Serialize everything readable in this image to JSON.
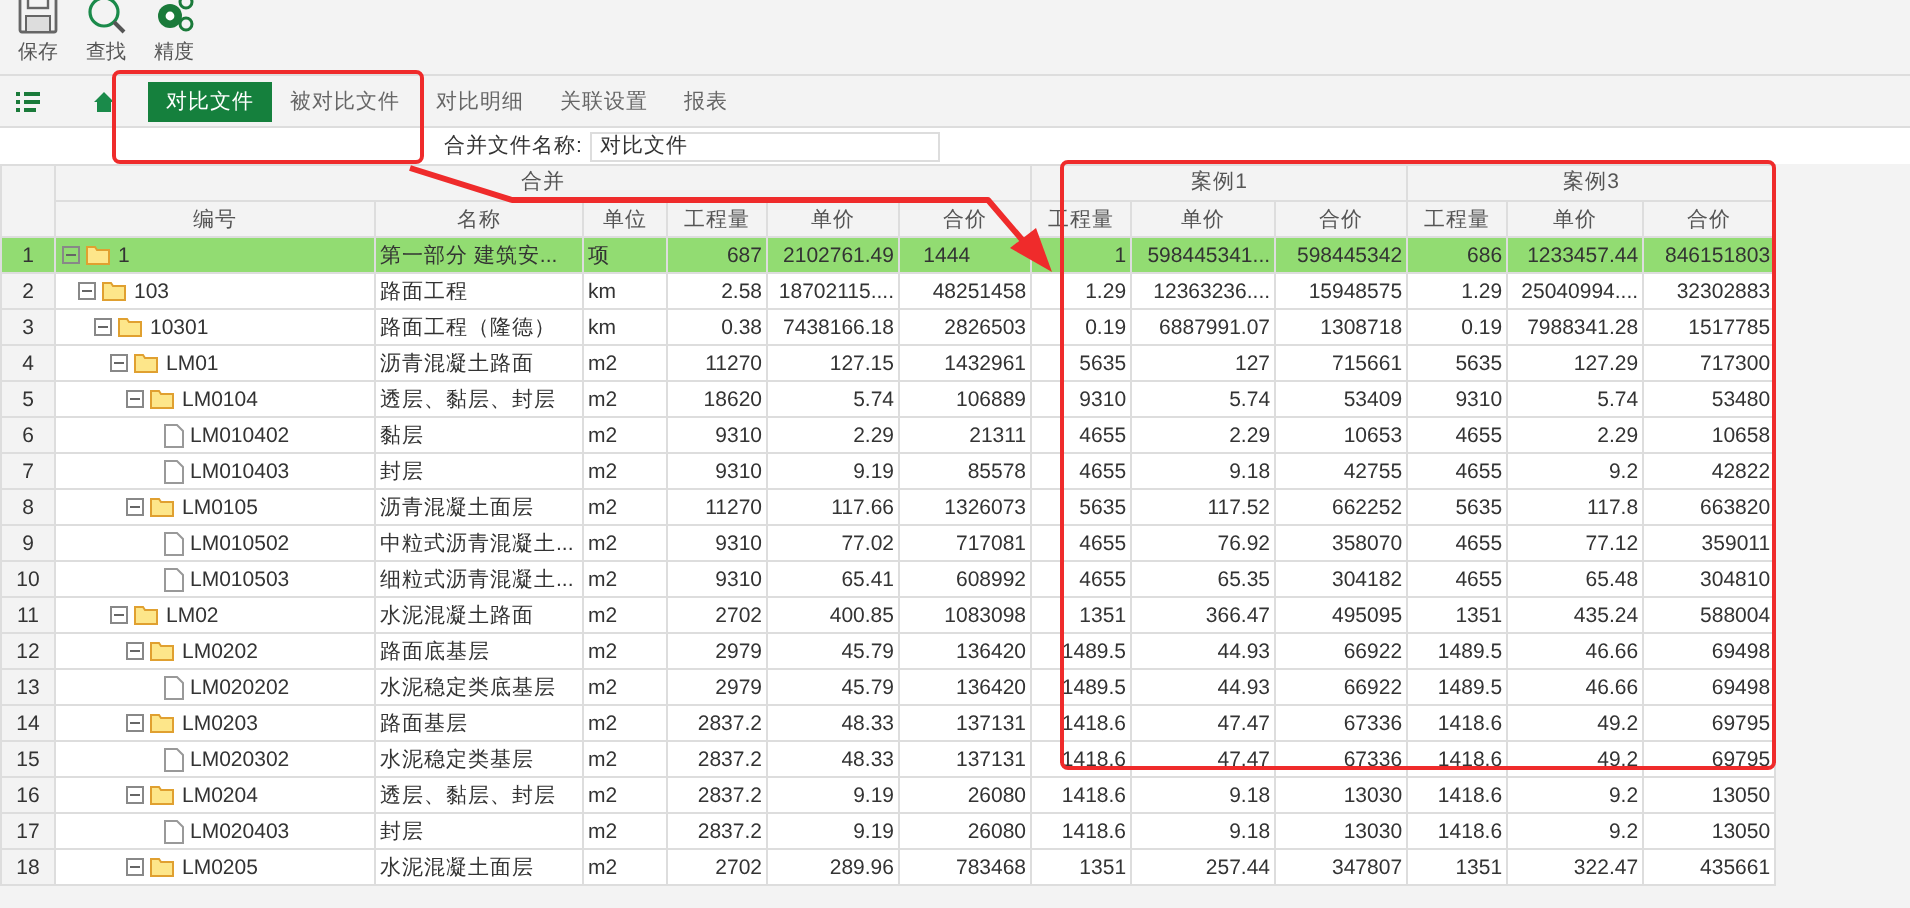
{
  "toolbar": [
    {
      "kind": "save",
      "label": "保存"
    },
    {
      "kind": "search",
      "label": "查找"
    },
    {
      "kind": "gears",
      "label": "精度"
    }
  ],
  "tabs": [
    {
      "label": "对比文件",
      "selected": true
    },
    {
      "label": "被对比文件",
      "selected": false
    },
    {
      "label": "对比明细",
      "selected": false
    },
    {
      "label": "关联设置",
      "selected": false
    },
    {
      "label": "报表",
      "selected": false
    }
  ],
  "merge_file": {
    "label": "合并文件名称:",
    "value": "对比文件"
  },
  "table": {
    "groups": [
      {
        "label": "合并",
        "columns": [
          "编号",
          "名称",
          "单位",
          "工程量",
          "单价",
          "合价"
        ]
      },
      {
        "label": "案例1",
        "columns": [
          "工程量",
          "单价",
          "合价"
        ]
      },
      {
        "label": "案例3",
        "columns": [
          "工程量",
          "单价",
          "合价"
        ]
      }
    ],
    "rows": [
      {
        "num": "1",
        "code": "1",
        "kind": "folder",
        "expanded": true,
        "selected": true,
        "cells": [
          "第一部分 建筑安...",
          "项",
          "687",
          "2102761.49",
          "1444",
          "1",
          "598445341...",
          "598445342",
          "686",
          "1233457.44",
          "846151803"
        ],
        "children": [
          {
            "num": "2",
            "code": "103",
            "kind": "folder",
            "expanded": true,
            "selected": false,
            "cells": [
              "路面工程",
              "km",
              "2.58",
              "18702115....",
              "48251458",
              "1.29",
              "12363236....",
              "15948575",
              "1.29",
              "25040994....",
              "32302883"
            ],
            "children": [
              {
                "num": "3",
                "code": "10301",
                "kind": "folder",
                "expanded": true,
                "selected": false,
                "cells": [
                  "路面工程（隆德）",
                  "km",
                  "0.38",
                  "7438166.18",
                  "2826503",
                  "0.19",
                  "6887991.07",
                  "1308718",
                  "0.19",
                  "7988341.28",
                  "1517785"
                ],
                "children": [
                  {
                    "num": "4",
                    "code": "LM01",
                    "kind": "folder",
                    "expanded": true,
                    "selected": false,
                    "cells": [
                      "沥青混凝土路面",
                      "m2",
                      "11270",
                      "127.15",
                      "1432961",
                      "5635",
                      "127",
                      "715661",
                      "5635",
                      "127.29",
                      "717300"
                    ],
                    "children": [
                      {
                        "num": "5",
                        "code": "LM0104",
                        "kind": "folder",
                        "expanded": true,
                        "selected": false,
                        "cells": [
                          "透层、黏层、封层",
                          "m2",
                          "18620",
                          "5.74",
                          "106889",
                          "9310",
                          "5.74",
                          "53409",
                          "9310",
                          "5.74",
                          "53480"
                        ],
                        "children": [
                          {
                            "num": "6",
                            "code": "LM010402",
                            "kind": "file",
                            "selected": false,
                            "cells": [
                              "黏层",
                              "m2",
                              "9310",
                              "2.29",
                              "21311",
                              "4655",
                              "2.29",
                              "10653",
                              "4655",
                              "2.29",
                              "10658"
                            ]
                          },
                          {
                            "num": "7",
                            "code": "LM010403",
                            "kind": "file",
                            "selected": false,
                            "cells": [
                              "封层",
                              "m2",
                              "9310",
                              "9.19",
                              "85578",
                              "4655",
                              "9.18",
                              "42755",
                              "4655",
                              "9.2",
                              "42822"
                            ]
                          }
                        ]
                      },
                      {
                        "num": "8",
                        "code": "LM0105",
                        "kind": "folder",
                        "expanded": true,
                        "selected": false,
                        "cells": [
                          "沥青混凝土面层",
                          "m2",
                          "11270",
                          "117.66",
                          "1326073",
                          "5635",
                          "117.52",
                          "662252",
                          "5635",
                          "117.8",
                          "663820"
                        ],
                        "children": [
                          {
                            "num": "9",
                            "code": "LM010502",
                            "kind": "file",
                            "selected": false,
                            "cells": [
                              "中粒式沥青混凝土...",
                              "m2",
                              "9310",
                              "77.02",
                              "717081",
                              "4655",
                              "76.92",
                              "358070",
                              "4655",
                              "77.12",
                              "359011"
                            ]
                          },
                          {
                            "num": "10",
                            "code": "LM010503",
                            "kind": "file",
                            "selected": false,
                            "cells": [
                              "细粒式沥青混凝土...",
                              "m2",
                              "9310",
                              "65.41",
                              "608992",
                              "4655",
                              "65.35",
                              "304182",
                              "4655",
                              "65.48",
                              "304810"
                            ]
                          }
                        ]
                      }
                    ]
                  },
                  {
                    "num": "11",
                    "code": "LM02",
                    "kind": "folder",
                    "expanded": true,
                    "selected": false,
                    "cells": [
                      "水泥混凝土路面",
                      "m2",
                      "2702",
                      "400.85",
                      "1083098",
                      "1351",
                      "366.47",
                      "495095",
                      "1351",
                      "435.24",
                      "588004"
                    ],
                    "children": [
                      {
                        "num": "12",
                        "code": "LM0202",
                        "kind": "folder",
                        "expanded": true,
                        "selected": false,
                        "cells": [
                          "路面底基层",
                          "m2",
                          "2979",
                          "45.79",
                          "136420",
                          "1489.5",
                          "44.93",
                          "66922",
                          "1489.5",
                          "46.66",
                          "69498"
                        ],
                        "children": [
                          {
                            "num": "13",
                            "code": "LM020202",
                            "kind": "file",
                            "selected": false,
                            "cells": [
                              "水泥稳定类底基层",
                              "m2",
                              "2979",
                              "45.79",
                              "136420",
                              "1489.5",
                              "44.93",
                              "66922",
                              "1489.5",
                              "46.66",
                              "69498"
                            ]
                          }
                        ]
                      },
                      {
                        "num": "14",
                        "code": "LM0203",
                        "kind": "folder",
                        "expanded": true,
                        "selected": false,
                        "cells": [
                          "路面基层",
                          "m2",
                          "2837.2",
                          "48.33",
                          "137131",
                          "1418.6",
                          "47.47",
                          "67336",
                          "1418.6",
                          "49.2",
                          "69795"
                        ],
                        "children": [
                          {
                            "num": "15",
                            "code": "LM020302",
                            "kind": "file",
                            "selected": false,
                            "cells": [
                              "水泥稳定类基层",
                              "m2",
                              "2837.2",
                              "48.33",
                              "137131",
                              "1418.6",
                              "47.47",
                              "67336",
                              "1418.6",
                              "49.2",
                              "69795"
                            ]
                          }
                        ]
                      },
                      {
                        "num": "16",
                        "code": "LM0204",
                        "kind": "folder",
                        "expanded": true,
                        "selected": false,
                        "cells": [
                          "透层、黏层、封层",
                          "m2",
                          "2837.2",
                          "9.19",
                          "26080",
                          "1418.6",
                          "9.18",
                          "13030",
                          "1418.6",
                          "9.2",
                          "13050"
                        ],
                        "children": [
                          {
                            "num": "17",
                            "code": "LM020403",
                            "kind": "file",
                            "selected": false,
                            "cells": [
                              "封层",
                              "m2",
                              "2837.2",
                              "9.19",
                              "26080",
                              "1418.6",
                              "9.18",
                              "13030",
                              "1418.6",
                              "9.2",
                              "13050"
                            ]
                          }
                        ]
                      },
                      {
                        "num": "18",
                        "code": "LM0205",
                        "kind": "folder",
                        "expanded": true,
                        "selected": false,
                        "cells": [
                          "水泥混凝土面层",
                          "m2",
                          "2702",
                          "289.96",
                          "783468",
                          "1351",
                          "257.44",
                          "347807",
                          "1351",
                          "322.47",
                          "435661"
                        ]
                      }
                    ]
                  }
                ]
              }
            ]
          }
        ]
      }
    ]
  }
}
